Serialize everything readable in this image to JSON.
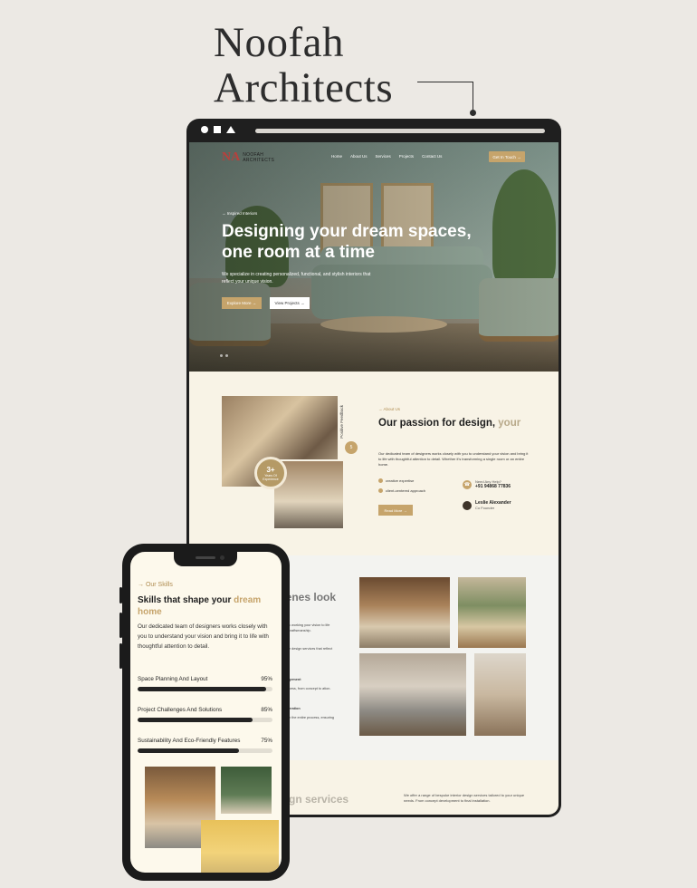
{
  "brand": {
    "line1": "Noofah",
    "line2": "Architects"
  },
  "site": {
    "logo_mark": "NA",
    "logo_line1": "NOOFAH",
    "logo_line2": "ARCHITECTS",
    "nav": [
      "Home",
      "About Us",
      "Services",
      "Projects",
      "Contact Us"
    ],
    "nav_cta": "Get In Touch  →",
    "hero": {
      "tag": "→  Inspired Interiors",
      "title": "Designing your dream spaces, one room at a time",
      "text": "We specialize in creating personalized, functional, and stylish interiors that reflect your unique vision.",
      "btn_primary": "Explore More  →",
      "btn_secondary": "View Projects  →"
    },
    "about": {
      "tag": "→  About Us",
      "title": "Our passion for design, ",
      "title_muted": "your",
      "text": "Our dedicated team of designers works closely with you to understand your vision and bring it to life with thoughtful attention to detail. Whether it's transforming a single room or an entire home.",
      "features": [
        "creative expertise",
        "client-centered approach"
      ],
      "help_label": "Need Any Help?",
      "help_phone": "+91 94868 77836",
      "founder_name": "Leslie Alexander",
      "founder_role": "Co Founder",
      "button": "Read More  →",
      "badge_num": "3+",
      "badge_label": "Years Of Experience",
      "vertical_tag": "Positive Feedback",
      "circle": "5"
    },
    "scenes": {
      "title": "cenes look",
      "texts": [
        "k working your vision to life craftsmanship.",
        "e design services that reflect",
        "gement",
        "cess, from concept to ation.",
        "eration",
        "h the entire process, ensuring"
      ]
    },
    "services": {
      "title": "sign services",
      "text": "We offer a range of bespoke interior design services tailored to your unique needs. From concept development to final installation."
    }
  },
  "phone": {
    "tag": "→  Our Skills",
    "title_dark": "Skills that shape your ",
    "title_gold": "dream home",
    "text": "Our dedicated team of designers works closely with you to understand your vision and bring it to life with thoughtful attention to detail.",
    "skills": [
      {
        "label": "Space Planning And Layout",
        "value": "95%",
        "fill": 95
      },
      {
        "label": "Project Challenges And Solutions",
        "value": "85%",
        "fill": 85
      },
      {
        "label": "Sustainability And Eco-Friendly Features",
        "value": "75%",
        "fill": 75
      }
    ]
  }
}
